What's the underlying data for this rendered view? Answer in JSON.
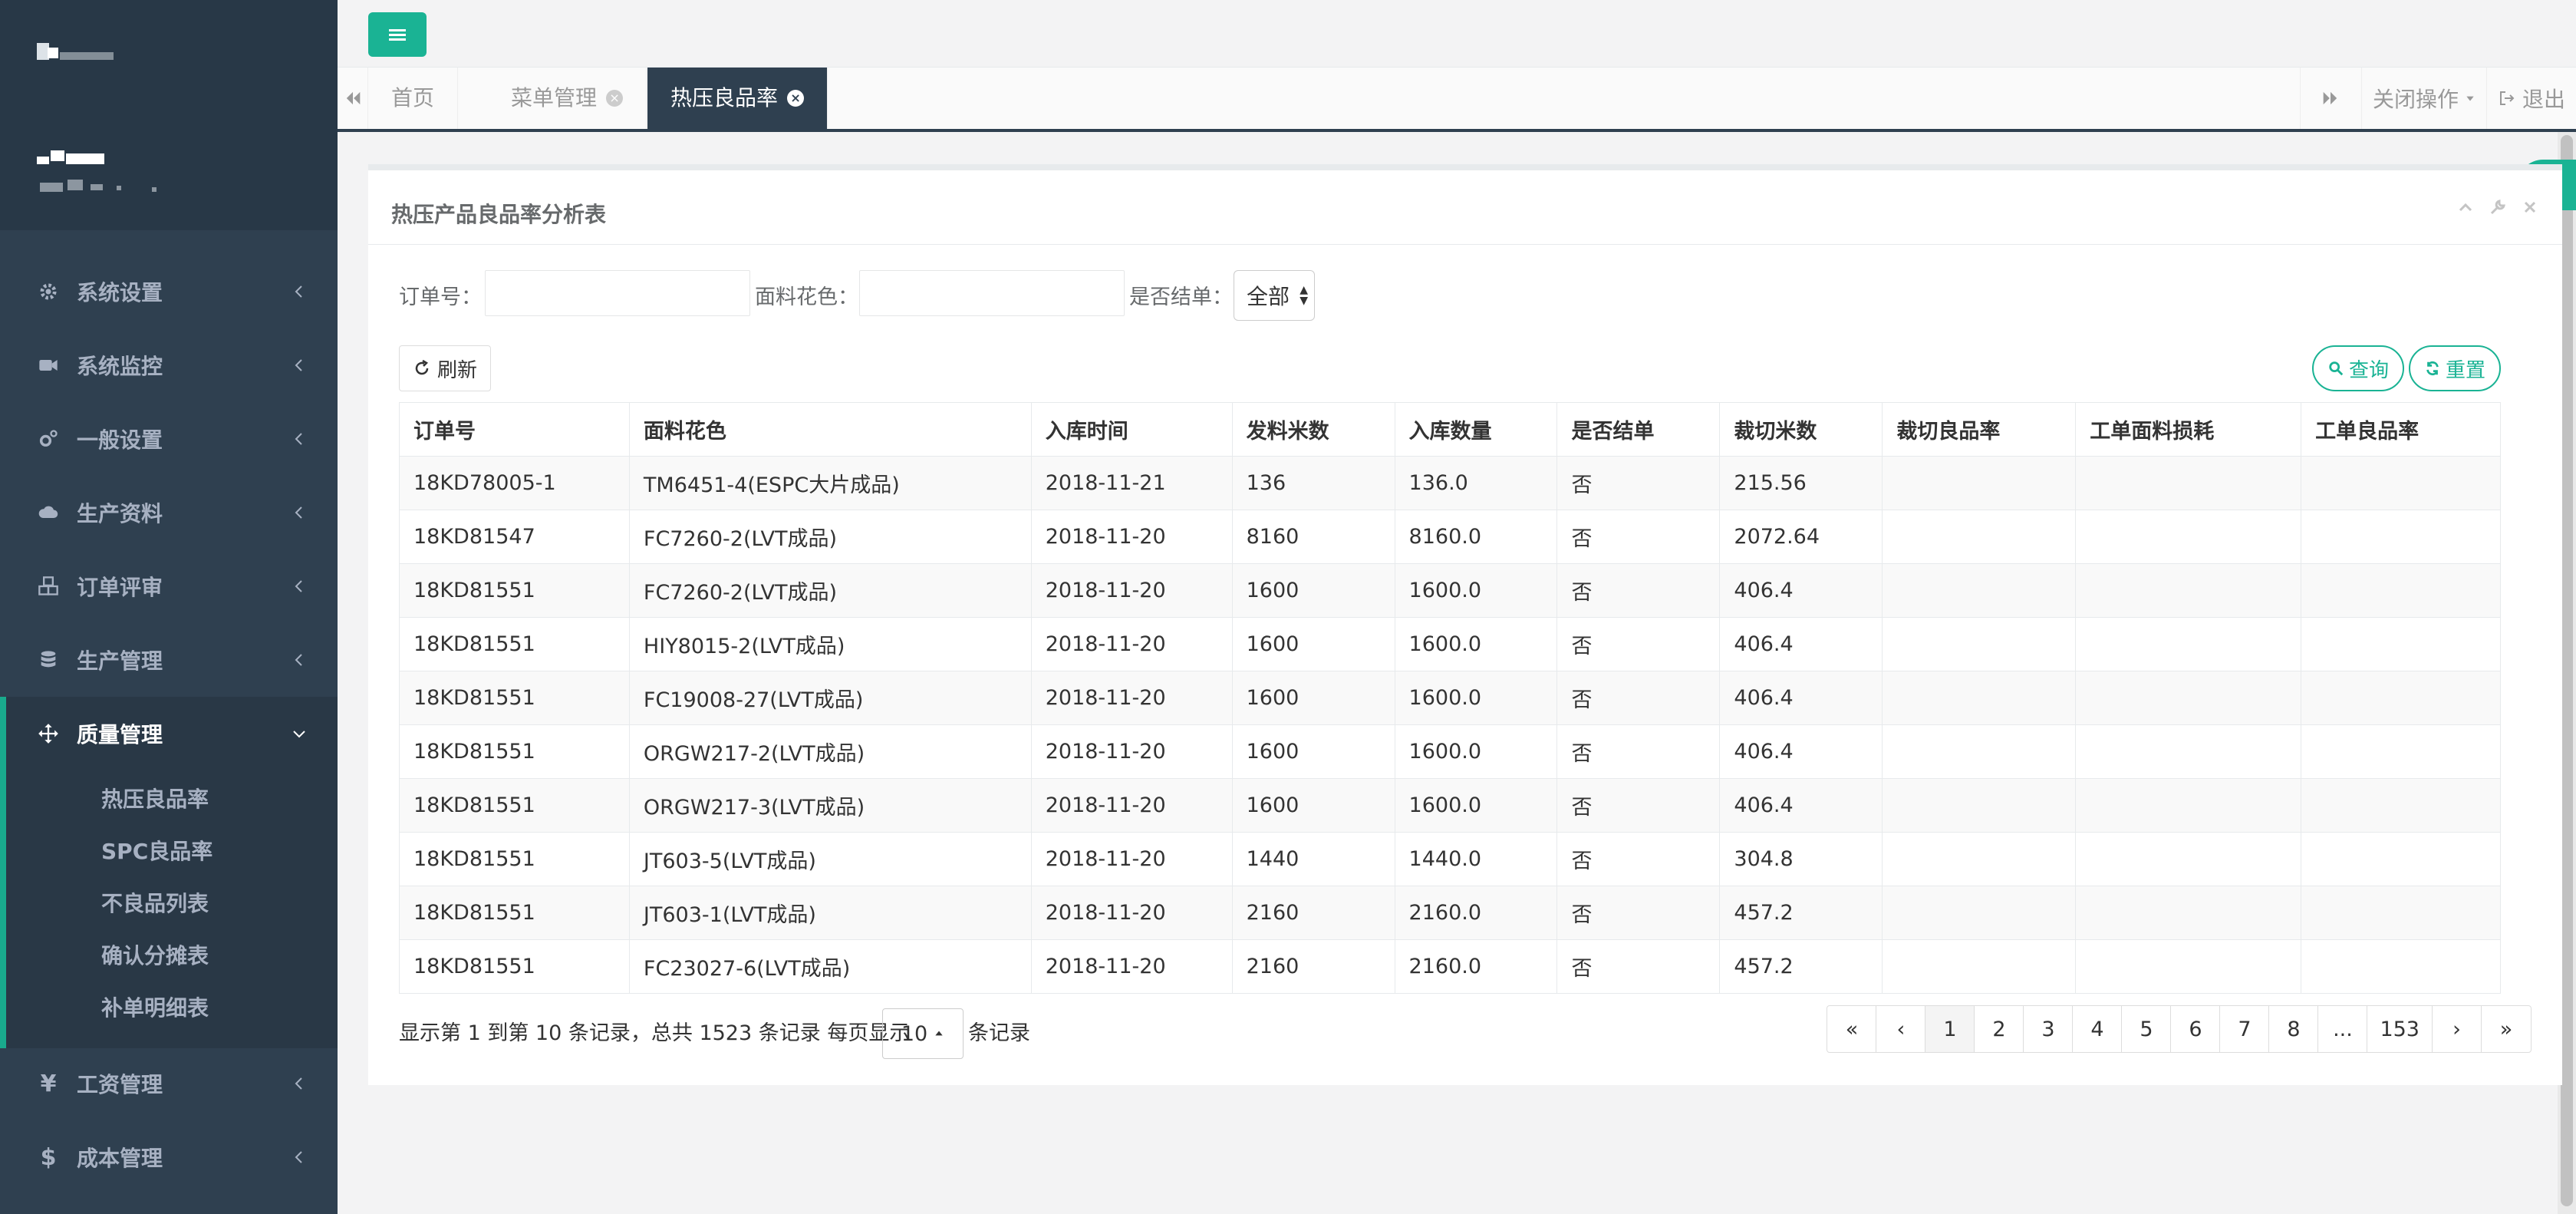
{
  "sidebar": {
    "menu": [
      {
        "label": "系统设置"
      },
      {
        "label": "系统监控"
      },
      {
        "label": "一般设置"
      },
      {
        "label": "生产资料"
      },
      {
        "label": "订单评审"
      },
      {
        "label": "生产管理"
      },
      {
        "label": "质量管理"
      },
      {
        "label": "工资管理",
        "prefix": "¥"
      },
      {
        "label": "成本管理",
        "prefix": "$"
      }
    ],
    "submenu": [
      {
        "label": "热压良品率"
      },
      {
        "label": "SPC良品率"
      },
      {
        "label": "不良品列表"
      },
      {
        "label": "确认分摊表"
      },
      {
        "label": "补单明细表"
      }
    ]
  },
  "tabs": [
    {
      "label": "首页"
    },
    {
      "label": "菜单管理"
    },
    {
      "label": "热压良品率"
    }
  ],
  "toolbar": {
    "close_ops": "关闭操作",
    "logout": "退出"
  },
  "panel": {
    "title": "热压产品良品率分析表"
  },
  "filters": {
    "order_no_label": "订单号：",
    "order_no_value": "",
    "fabric_label": "面料花色：",
    "fabric_value": "",
    "settled_label": "是否结单：",
    "settled_value": "全部"
  },
  "buttons": {
    "refresh": "刷新",
    "search": "查询",
    "reset": "重置"
  },
  "table": {
    "columns": [
      "订单号",
      "面料花色",
      "入库时间",
      "发料米数",
      "入库数量",
      "是否结单",
      "裁切米数",
      "裁切良品率",
      "工单面料损耗",
      "工单良品率"
    ],
    "rows": [
      [
        "18KD78005-1",
        "TM6451-4(ESPC大片成品)",
        "2018-11-21",
        "136",
        "136.0",
        "否",
        "215.56",
        "",
        "",
        ""
      ],
      [
        "18KD81547",
        "FC7260-2(LVT成品)",
        "2018-11-20",
        "8160",
        "8160.0",
        "否",
        "2072.64",
        "",
        "",
        ""
      ],
      [
        "18KD81551",
        "FC7260-2(LVT成品)",
        "2018-11-20",
        "1600",
        "1600.0",
        "否",
        "406.4",
        "",
        "",
        ""
      ],
      [
        "18KD81551",
        "HIY8015-2(LVT成品)",
        "2018-11-20",
        "1600",
        "1600.0",
        "否",
        "406.4",
        "",
        "",
        ""
      ],
      [
        "18KD81551",
        "FC19008-27(LVT成品)",
        "2018-11-20",
        "1600",
        "1600.0",
        "否",
        "406.4",
        "",
        "",
        ""
      ],
      [
        "18KD81551",
        "ORGW217-2(LVT成品)",
        "2018-11-20",
        "1600",
        "1600.0",
        "否",
        "406.4",
        "",
        "",
        ""
      ],
      [
        "18KD81551",
        "ORGW217-3(LVT成品)",
        "2018-11-20",
        "1600",
        "1600.0",
        "否",
        "406.4",
        "",
        "",
        ""
      ],
      [
        "18KD81551",
        "JT603-5(LVT成品)",
        "2018-11-20",
        "1440",
        "1440.0",
        "否",
        "304.8",
        "",
        "",
        ""
      ],
      [
        "18KD81551",
        "JT603-1(LVT成品)",
        "2018-11-20",
        "2160",
        "2160.0",
        "否",
        "457.2",
        "",
        "",
        ""
      ],
      [
        "18KD81551",
        "FC23027-6(LVT成品)",
        "2018-11-20",
        "2160",
        "2160.0",
        "否",
        "457.2",
        "",
        "",
        ""
      ]
    ]
  },
  "pagination": {
    "info": "显示第 1 到第 10 条记录，总共 1523 条记录  每页显示",
    "page_size": "10",
    "suffix": "条记录",
    "pages": [
      "«",
      "‹",
      "1",
      "2",
      "3",
      "4",
      "5",
      "6",
      "7",
      "8",
      "...",
      "153",
      "›",
      "»"
    ],
    "current": "1"
  },
  "colors": {
    "sidebar_bg": "#2f4050",
    "accent": "#1ab394"
  }
}
